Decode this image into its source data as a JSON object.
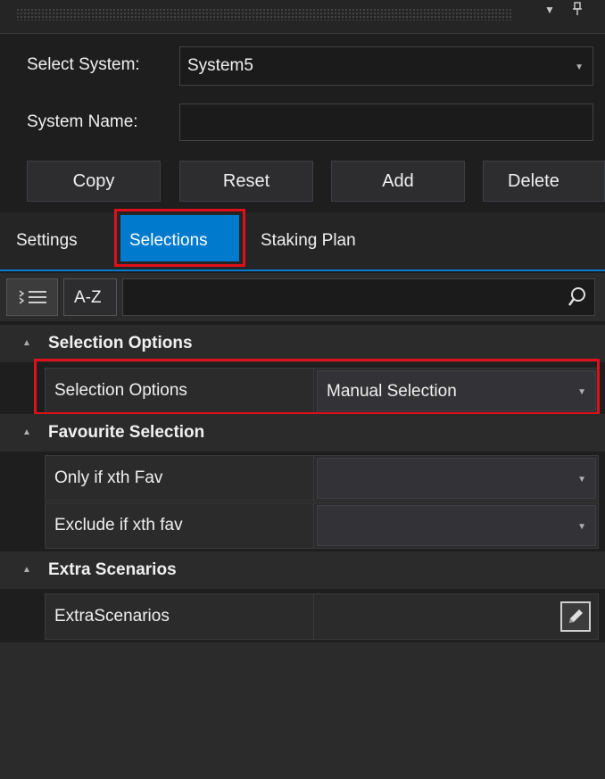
{
  "titlebar": {
    "dropdown_glyph": "▼",
    "pin_glyph": "🖈"
  },
  "system": {
    "select_label": "Select System:",
    "select_value": "System5",
    "name_label": "System Name:",
    "name_value": ""
  },
  "actions": {
    "copy": "Copy",
    "reset": "Reset",
    "add": "Add",
    "delete": "Delete"
  },
  "tabs": [
    {
      "label": "Settings",
      "active": false
    },
    {
      "label": "Selections",
      "active": true
    },
    {
      "label": "Staking Plan",
      "active": false
    }
  ],
  "toolbar": {
    "sort_az": "A-Z",
    "search_value": "",
    "icons": [
      "categorized-icon",
      "search-icon"
    ]
  },
  "categories": [
    {
      "title": "Selection Options",
      "properties": [
        {
          "name": "Selection Options",
          "value": "Manual Selection",
          "editor": "dropdown"
        }
      ]
    },
    {
      "title": "Favourite Selection",
      "properties": [
        {
          "name": "Only if xth Fav",
          "value": "",
          "editor": "dropdown"
        },
        {
          "name": "Exclude if xth fav",
          "value": "",
          "editor": "dropdown"
        }
      ]
    },
    {
      "title": "Extra Scenarios",
      "properties": [
        {
          "name": "ExtraScenarios",
          "value": "",
          "editor": "edit-button"
        }
      ]
    }
  ],
  "colors": {
    "accent": "#007acc",
    "highlight": "#e0101a",
    "background": "#1e1e1e",
    "panel": "#2b2b2b"
  }
}
